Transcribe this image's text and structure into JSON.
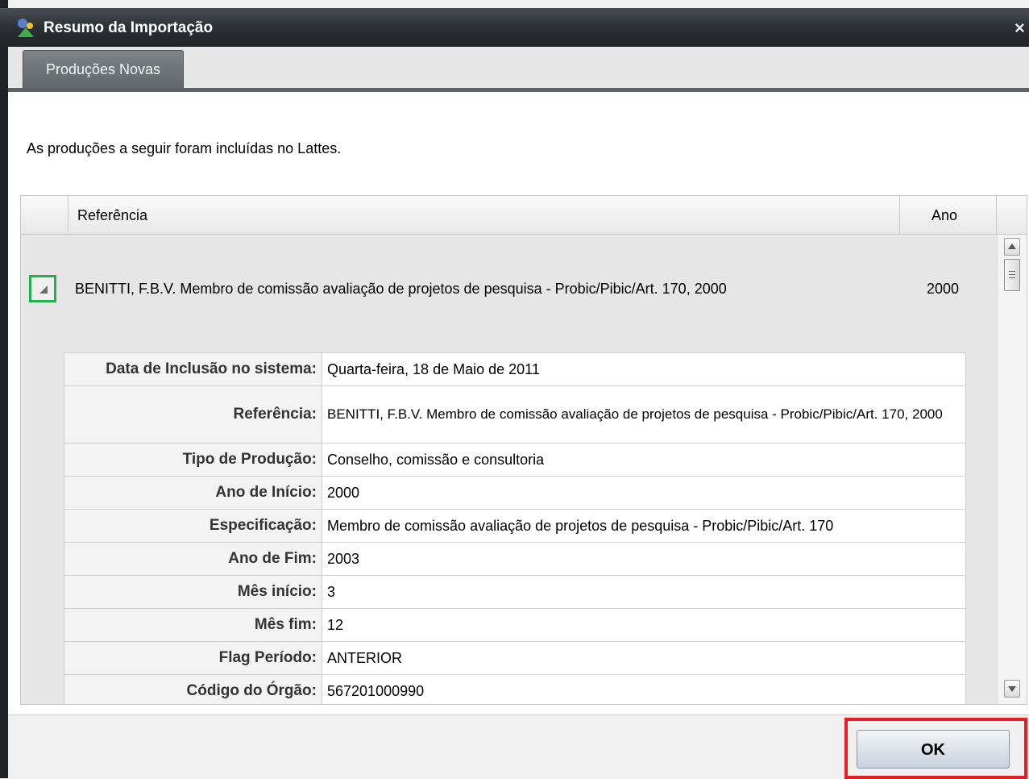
{
  "window": {
    "title": "Resumo da Importação",
    "close_glyph": "×"
  },
  "tabs": [
    {
      "label": "Produções Novas",
      "selected": true
    }
  ],
  "intro_text": "As produções a seguir foram incluídas no Lattes.",
  "table": {
    "columns": [
      "Referência",
      "Ano"
    ],
    "row": {
      "reference": "BENITTI, F.B.V. Membro de comissão avaliação de projetos de pesquisa - Probic/Pibic/Art. 170, 2000",
      "year": "2000",
      "expanded": true
    },
    "details": [
      {
        "key": "Data de Inclusão no sistema:",
        "value": "Quarta-feira, 18 de Maio de 2011"
      },
      {
        "key": "Referência:",
        "value": "BENITTI, F.B.V. Membro de comissão avaliação de projetos de pesquisa - Probic/Pibic/Art. 170, 2000"
      },
      {
        "key": "Tipo de Produção:",
        "value": "Conselho, comissão e consultoria"
      },
      {
        "key": "Ano de Início:",
        "value": "2000"
      },
      {
        "key": "Especificação:",
        "value": "Membro de comissão avaliação de projetos de pesquisa - Probic/Pibic/Art. 170"
      },
      {
        "key": "Ano de Fim:",
        "value": "2003"
      },
      {
        "key": "Mês início:",
        "value": "3"
      },
      {
        "key": "Mês fim:",
        "value": "12"
      },
      {
        "key": "Flag Período:",
        "value": "ANTERIOR"
      },
      {
        "key": "Código do Órgão:",
        "value": "567201000990"
      }
    ]
  },
  "footer": {
    "ok_label": "OK"
  },
  "colors": {
    "highlight_ok": "#e31e24",
    "highlight_toggle": "#22b14c",
    "titlebar": "#2c3035"
  },
  "icons": [
    "app-icon",
    "close-icon",
    "collapse-triangle-icon",
    "scroll-up-icon",
    "scroll-down-icon"
  ]
}
